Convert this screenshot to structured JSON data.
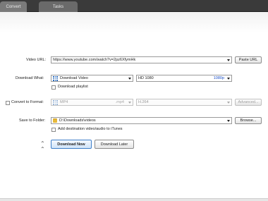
{
  "tabs": [
    {
      "label": "Convert"
    },
    {
      "label": "Tasks"
    }
  ],
  "video_url": {
    "label": "Video URL:",
    "value": "https://www.youtube.com/watch?v=2pz6XfymHk",
    "paste_button": "Paste URL"
  },
  "download_what": {
    "label": "Download What:",
    "selected": "Download Video",
    "quality_label": "HD 1080",
    "quality_value": "1080p",
    "playlist_checkbox": "Download playlist"
  },
  "convert_to": {
    "label": "Convert to Format:",
    "format": "MP4",
    "format_ext": ".mp4",
    "codec": "H.264",
    "advanced_button": "Advanced..."
  },
  "save_to": {
    "label": "Save to Folder:",
    "path": "D:\\Downloads\\videos",
    "browse_button": "Browse...",
    "itunes_checkbox": "Add destination video/audio to iTunes"
  },
  "actions": {
    "download_now": "Download Now",
    "download_later": "Download Later"
  },
  "icons": {
    "collapse": "chevron-double-up-icon",
    "format": "grid-icon",
    "folder": "folder-icon"
  },
  "colors": {
    "accent": "#2f6fbf",
    "link": "#1a4fc7",
    "tabbar": "#3a3a3a"
  }
}
